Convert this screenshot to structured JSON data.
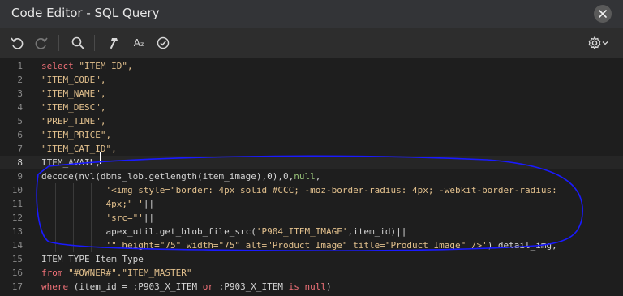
{
  "window": {
    "title": "Code Editor - SQL Query"
  },
  "toolbar": {
    "undo_icon": "undo-icon",
    "redo_icon": "redo-icon",
    "search_icon": "search-icon",
    "hammer_icon": "hammer-icon",
    "font_size_icon": "font-size-icon",
    "font_size_label": "A",
    "check_icon": "check-circle-icon",
    "settings_icon": "gear-icon",
    "dropdown_icon": "chevron-down-icon"
  },
  "editor": {
    "active_line": 8,
    "lines": [
      {
        "n": "1",
        "parts": [
          {
            "t": "select",
            "c": "kw"
          },
          {
            "t": " \"ITEM_ID\",",
            "c": "str"
          }
        ]
      },
      {
        "n": "2",
        "parts": [
          {
            "t": "\"ITEM_CODE\",",
            "c": "str"
          }
        ]
      },
      {
        "n": "3",
        "parts": [
          {
            "t": "\"ITEM_NAME\",",
            "c": "str"
          }
        ]
      },
      {
        "n": "4",
        "parts": [
          {
            "t": "\"ITEM_DESC\",",
            "c": "str"
          }
        ]
      },
      {
        "n": "5",
        "parts": [
          {
            "t": "\"PREP_TIME\",",
            "c": "str"
          }
        ]
      },
      {
        "n": "6",
        "parts": [
          {
            "t": "\"ITEM_PRICE\",",
            "c": "str"
          }
        ]
      },
      {
        "n": "7",
        "parts": [
          {
            "t": "\"ITEM_CAT_ID\",",
            "c": "str"
          }
        ]
      },
      {
        "n": "8",
        "parts": [
          {
            "t": "ITEM_AVAIL,",
            "c": "fn"
          }
        ]
      },
      {
        "n": "9",
        "parts": [
          {
            "t": "decode(nvl(dbms_lob.getlength(item_image),0),0,",
            "c": "fn"
          },
          {
            "t": "null",
            "c": "nul"
          },
          {
            "t": ",",
            "c": "fn"
          }
        ]
      },
      {
        "n": "10",
        "parts": [
          {
            "t": "            ",
            "c": "fn"
          },
          {
            "t": "'<img style=\"border: 4px solid #CCC; -moz-border-radius: 4px; -webkit-border-radius:",
            "c": "str"
          }
        ]
      },
      {
        "n": "11",
        "parts": [
          {
            "t": "            ",
            "c": "fn"
          },
          {
            "t": "4px;\" '",
            "c": "str"
          },
          {
            "t": "||",
            "c": "fn"
          }
        ]
      },
      {
        "n": "12",
        "parts": [
          {
            "t": "            ",
            "c": "fn"
          },
          {
            "t": "'src=\"'",
            "c": "str"
          },
          {
            "t": "||",
            "c": "fn"
          }
        ]
      },
      {
        "n": "13",
        "parts": [
          {
            "t": "            apex_util.get_blob_file_src(",
            "c": "fn"
          },
          {
            "t": "'P904_ITEM_IMAGE'",
            "c": "str"
          },
          {
            "t": ",item_id)||",
            "c": "fn"
          }
        ]
      },
      {
        "n": "14",
        "parts": [
          {
            "t": "            ",
            "c": "fn"
          },
          {
            "t": "'\" height=\"75\" width=\"75\" alt=\"Product Image\" title=\"Product Image\" />'",
            "c": "str"
          },
          {
            "t": ") detail_img,",
            "c": "fn"
          }
        ]
      },
      {
        "n": "15",
        "parts": [
          {
            "t": "ITEM_TYPE Item_Type",
            "c": "fn"
          }
        ]
      },
      {
        "n": "16",
        "parts": [
          {
            "t": "from",
            "c": "kw"
          },
          {
            "t": " \"#OWNER#\".\"ITEM_MASTER\"",
            "c": "str"
          }
        ]
      },
      {
        "n": "17",
        "parts": [
          {
            "t": "where",
            "c": "kw"
          },
          {
            "t": " (item_id = :P903_X_ITEM ",
            "c": "fn"
          },
          {
            "t": "or",
            "c": "kw"
          },
          {
            "t": " :P903_X_ITEM ",
            "c": "fn"
          },
          {
            "t": "is",
            "c": "kw"
          },
          {
            "t": " ",
            "c": "fn"
          },
          {
            "t": "null",
            "c": "kw"
          },
          {
            "t": ")",
            "c": "fn"
          }
        ]
      }
    ]
  },
  "colors": {
    "annotation_stroke": "#1a1aff",
    "keyword": "#f07178",
    "string": "#e2c08d",
    "null_literal": "#98c379"
  }
}
